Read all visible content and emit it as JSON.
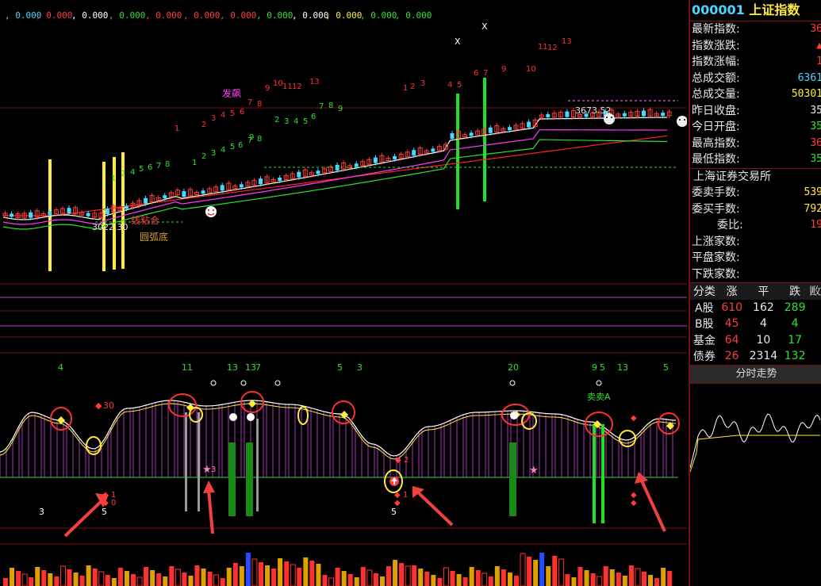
{
  "top_values": [
    "0.000",
    "0.000",
    "0.000",
    "0.000",
    "0.000",
    "0.000",
    "0.000",
    "0.000",
    "0.000",
    "0.000",
    "0.000",
    "0.000"
  ],
  "top_value_colors": [
    "#49d6ff",
    "#ff3b3b",
    "#ffffff",
    "#30e030",
    "#ff3b3b",
    "#ff3b3b",
    "#ff3b3b",
    "#30e030",
    "#ffffff",
    "#ffeb3b",
    "#30e030",
    "#30e030"
  ],
  "main": {
    "low_label": "3022.30",
    "high_label": "3673.52",
    "label_fafei": "发飙",
    "label_xiannian": "线粘合",
    "label_yuanhu": "圆弧底",
    "marker_x1": "X",
    "marker_x2": "X",
    "label_maimai": "卖卖A"
  },
  "indicator_numbers": [
    "4",
    "11",
    "13",
    "13",
    "7",
    "5",
    "3",
    "20",
    "9",
    "5",
    "13",
    "5"
  ],
  "indicator_labels": {
    "n30": "30",
    "n1": "1",
    "n2": "2",
    "n3": "3",
    "n5a": "5",
    "n5b": "5",
    "n1b": "1",
    "n0": "0"
  },
  "panel": {
    "code": "000001",
    "name": "上证指数",
    "stats": [
      {
        "label": "最新指数:",
        "value": "36",
        "color": "#ff3b3b"
      },
      {
        "label": "指数涨跌:",
        "value": "▲",
        "color": "#ff3b3b"
      },
      {
        "label": "指数涨幅:",
        "value": "1",
        "color": "#ff3b3b"
      },
      {
        "label": "总成交额:",
        "value": "6361",
        "color": "#49d6ff"
      },
      {
        "label": "总成交量:",
        "value": "50301",
        "color": "#ffeb3b"
      },
      {
        "label": "昨日收盘:",
        "value": "35",
        "color": "#e8e8e8"
      },
      {
        "label": "今日开盘:",
        "value": "35",
        "color": "#30e030"
      },
      {
        "label": "最高指数:",
        "value": "36",
        "color": "#ff3b3b"
      },
      {
        "label": "最低指数:",
        "value": "35",
        "color": "#30e030"
      }
    ],
    "exchange": "上海证券交易所",
    "orders": [
      {
        "label": "委卖手数:",
        "value": "539",
        "color": "#ffeb3b"
      },
      {
        "label": "委买手数:",
        "value": "792",
        "color": "#ffeb3b"
      },
      {
        "label": "委比:",
        "value": "19",
        "color": "#ff3b3b",
        "indent": true
      },
      {
        "label": "上涨家数:",
        "value": "",
        "color": "#ff3b3b"
      },
      {
        "label": "平盘家数:",
        "value": "",
        "color": "#e8e8e8"
      },
      {
        "label": "下跌家数:",
        "value": "",
        "color": "#30e030"
      }
    ],
    "dist_header": [
      "分类",
      "涨",
      "平",
      "跌",
      "𢾺"
    ],
    "dist_rows": [
      {
        "name": "A股",
        "up": "610",
        "flat": "162",
        "down": "289"
      },
      {
        "name": "B股",
        "up": "45",
        "flat": "4",
        "down": "4"
      },
      {
        "name": "基金",
        "up": "64",
        "flat": "10",
        "down": "17"
      },
      {
        "name": "债券",
        "up": "26",
        "flat": "2314",
        "down": "132"
      }
    ],
    "tab_label": "分时走势"
  },
  "colors": {
    "up": "#ff3b3b",
    "down": "#49d6ff",
    "grid": "#7a1010",
    "ma5": "#ffffff",
    "ma10": "#ff3bff",
    "ma20": "#30e030",
    "ma60": "#ff2020"
  }
}
